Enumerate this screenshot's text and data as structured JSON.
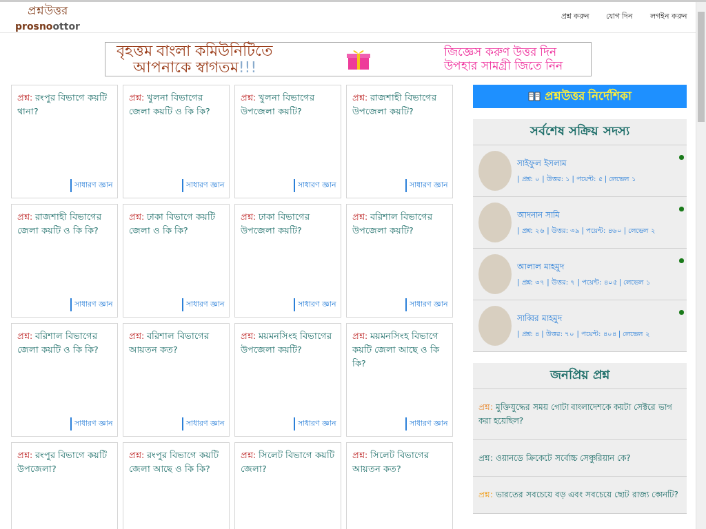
{
  "header": {
    "logo_bn": "প্রশ্নউত্তর",
    "logo_en_a": "prosno",
    "logo_en_b": "ottor",
    "nav": [
      "প্রশ্ন করুন",
      "যোগ দিন",
      "লগইন করুন"
    ]
  },
  "banner": {
    "welcome_line1": "বৃহত্তম বাংলা কমিউনিটিতে",
    "welcome_line2": "আপনাকে স্বাগতম",
    "exclaim": "!!!",
    "promo_line1": "জিজ্ঞেস করুণ উত্তর দিন",
    "promo_line2": "উপহার সামগ্রী জিতে নিন"
  },
  "questions": [
    {
      "prefix": "প্রশ্ন:",
      "text": "রংপুর বিভাগে কয়টি থানা?",
      "category": "সাধারণ জ্ঞান"
    },
    {
      "prefix": "প্রশ্ন:",
      "text": "খুলনা বিভাগের জেলা কয়টি ও কি কি?",
      "category": "সাধারণ জ্ঞান"
    },
    {
      "prefix": "প্রশ্ন:",
      "text": "খুলনা বিভাগের উপজেলা কয়টি?",
      "category": "সাধারণ জ্ঞান"
    },
    {
      "prefix": "প্রশ্ন:",
      "text": "রাজশাহী বিভাগের উপজেলা কয়টি?",
      "category": "সাধারণ জ্ঞান"
    },
    {
      "prefix": "প্রশ্ন:",
      "text": "রাজশাহী বিভাগের জেলা কয়টি ও কি কি?",
      "category": "সাধারণ জ্ঞান"
    },
    {
      "prefix": "প্রশ্ন:",
      "text": "ঢাকা বিভাগে কয়টি জেলা ও কি কি?",
      "category": "সাধারণ জ্ঞান"
    },
    {
      "prefix": "প্রশ্ন:",
      "text": "ঢাকা বিভাগের উপজেলা কয়টি?",
      "category": "সাধারণ জ্ঞান"
    },
    {
      "prefix": "প্রশ্ন:",
      "text": "বরিশাল বিভাগের উপজেলা কয়টি?",
      "category": "সাধারণ জ্ঞান"
    },
    {
      "prefix": "প্রশ্ন:",
      "text": "বরিশাল বিভাগের জেলা কয়টি ও কি কি?",
      "category": "সাধারণ জ্ঞান"
    },
    {
      "prefix": "প্রশ্ন:",
      "text": "বরিশাল বিভাগের আয়তন কত?",
      "category": "সাধারণ জ্ঞান"
    },
    {
      "prefix": "প্রশ্ন:",
      "text": "ময়মনসিংহ বিভাগের উপজেলা কয়টি?",
      "category": "সাধারণ জ্ঞান"
    },
    {
      "prefix": "প্রশ্ন:",
      "text": "ময়মনসিংহ বিভাগে কয়টি জেলা আছে ও কি কি?",
      "category": "সাধারণ জ্ঞান"
    },
    {
      "prefix": "প্রশ্ন:",
      "text": "রংপুর বিভাগে কয়টি উপজেলা?"
    },
    {
      "prefix": "প্রশ্ন:",
      "text": "রংপুর বিভাগে কয়টি জেলা আছে ও কি কি?"
    },
    {
      "prefix": "প্রশ্ন:",
      "text": "সিলেট বিভাগে কয়টি জেলা?"
    },
    {
      "prefix": "প্রশ্ন:",
      "text": "সিলেট বিভাগের আয়তন কত?"
    }
  ],
  "sidebar": {
    "guide_button": "প্রশ্নউত্তর নির্দেশিকা",
    "members_title": "সর্বশেষ সক্রিয় সদস্য",
    "members": [
      {
        "name": "সাইফুল ইসলাম",
        "stats": "| প্রশ্ন: ০ | উত্তর: ১ | পয়েন্ট: ৫ | লেভেল ১",
        "online": true,
        "color": "#1a7a1a"
      },
      {
        "name": "আদনান সামি",
        "stats": "| প্রশ্ন: ২৬ | উত্তর: ৩৯ | পয়েন্ট: ৪৬০ | লেভেল ২",
        "online": true,
        "color": "#1a7a1a"
      },
      {
        "name": "আলাল মাহমুদ",
        "stats": "| প্রশ্ন: ৩৭ | উত্তর: ৭ | পয়েন্ট: ৪০৫ | লেভেল ১",
        "online": true,
        "color": "#1a7a1a"
      },
      {
        "name": "সাব্বির মাহমুদ",
        "stats": "| প্রশ্ন: ৪ | উত্তর: ৭০ | পয়েন্ট: ৪০৪ | লেভেল ২",
        "online": true,
        "color": "#1a7a1a"
      }
    ],
    "popular_title": "জনপ্রিয় প্রশ্ন",
    "popular": [
      {
        "prefix": "প্রশ্ন:",
        "text": "মুক্তিযুদ্ধের সময় গোটা বাংলাদেশকে কয়টা সেক্টরে ভাগ করা হয়েছিল?",
        "color": "#e8862a"
      },
      {
        "prefix": "প্রশ্ন:",
        "text": "ওয়ানডে ক্রিকেটে সর্বোচ্চ সেঞ্চুরিয়ান কে?",
        "color": "#1f6f6a"
      },
      {
        "prefix": "প্রশ্ন:",
        "text": "ভারতের সবচেয়ে বড় এবং সবচেয়ে ছোট রাজ্য কোনটি?",
        "color": "#f0a020"
      }
    ]
  }
}
